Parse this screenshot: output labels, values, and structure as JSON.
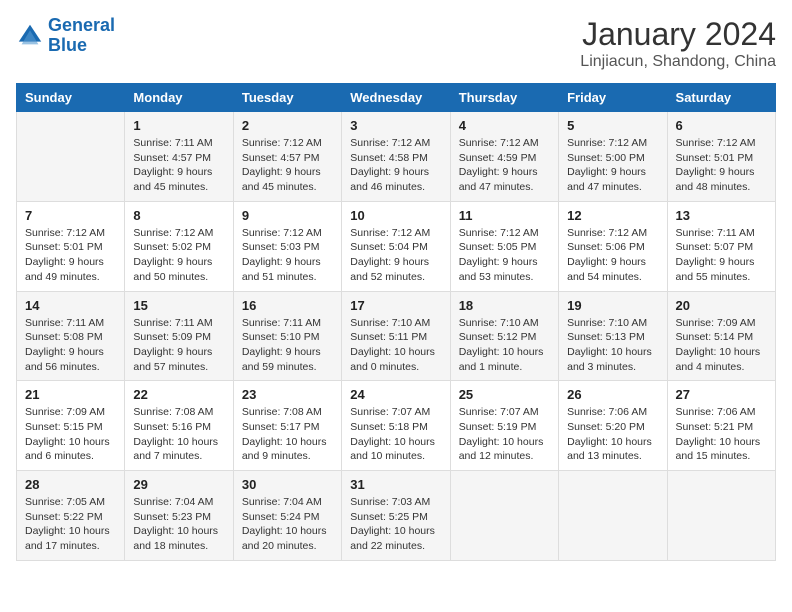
{
  "logo": {
    "text_general": "General",
    "text_blue": "Blue"
  },
  "title": "January 2024",
  "subtitle": "Linjiacun, Shandong, China",
  "header_days": [
    "Sunday",
    "Monday",
    "Tuesday",
    "Wednesday",
    "Thursday",
    "Friday",
    "Saturday"
  ],
  "weeks": [
    [
      {
        "day": "",
        "info": ""
      },
      {
        "day": "1",
        "info": "Sunrise: 7:11 AM\nSunset: 4:57 PM\nDaylight: 9 hours\nand 45 minutes."
      },
      {
        "day": "2",
        "info": "Sunrise: 7:12 AM\nSunset: 4:57 PM\nDaylight: 9 hours\nand 45 minutes."
      },
      {
        "day": "3",
        "info": "Sunrise: 7:12 AM\nSunset: 4:58 PM\nDaylight: 9 hours\nand 46 minutes."
      },
      {
        "day": "4",
        "info": "Sunrise: 7:12 AM\nSunset: 4:59 PM\nDaylight: 9 hours\nand 47 minutes."
      },
      {
        "day": "5",
        "info": "Sunrise: 7:12 AM\nSunset: 5:00 PM\nDaylight: 9 hours\nand 47 minutes."
      },
      {
        "day": "6",
        "info": "Sunrise: 7:12 AM\nSunset: 5:01 PM\nDaylight: 9 hours\nand 48 minutes."
      }
    ],
    [
      {
        "day": "7",
        "info": "Sunrise: 7:12 AM\nSunset: 5:01 PM\nDaylight: 9 hours\nand 49 minutes."
      },
      {
        "day": "8",
        "info": "Sunrise: 7:12 AM\nSunset: 5:02 PM\nDaylight: 9 hours\nand 50 minutes."
      },
      {
        "day": "9",
        "info": "Sunrise: 7:12 AM\nSunset: 5:03 PM\nDaylight: 9 hours\nand 51 minutes."
      },
      {
        "day": "10",
        "info": "Sunrise: 7:12 AM\nSunset: 5:04 PM\nDaylight: 9 hours\nand 52 minutes."
      },
      {
        "day": "11",
        "info": "Sunrise: 7:12 AM\nSunset: 5:05 PM\nDaylight: 9 hours\nand 53 minutes."
      },
      {
        "day": "12",
        "info": "Sunrise: 7:12 AM\nSunset: 5:06 PM\nDaylight: 9 hours\nand 54 minutes."
      },
      {
        "day": "13",
        "info": "Sunrise: 7:11 AM\nSunset: 5:07 PM\nDaylight: 9 hours\nand 55 minutes."
      }
    ],
    [
      {
        "day": "14",
        "info": "Sunrise: 7:11 AM\nSunset: 5:08 PM\nDaylight: 9 hours\nand 56 minutes."
      },
      {
        "day": "15",
        "info": "Sunrise: 7:11 AM\nSunset: 5:09 PM\nDaylight: 9 hours\nand 57 minutes."
      },
      {
        "day": "16",
        "info": "Sunrise: 7:11 AM\nSunset: 5:10 PM\nDaylight: 9 hours\nand 59 minutes."
      },
      {
        "day": "17",
        "info": "Sunrise: 7:10 AM\nSunset: 5:11 PM\nDaylight: 10 hours\nand 0 minutes."
      },
      {
        "day": "18",
        "info": "Sunrise: 7:10 AM\nSunset: 5:12 PM\nDaylight: 10 hours\nand 1 minute."
      },
      {
        "day": "19",
        "info": "Sunrise: 7:10 AM\nSunset: 5:13 PM\nDaylight: 10 hours\nand 3 minutes."
      },
      {
        "day": "20",
        "info": "Sunrise: 7:09 AM\nSunset: 5:14 PM\nDaylight: 10 hours\nand 4 minutes."
      }
    ],
    [
      {
        "day": "21",
        "info": "Sunrise: 7:09 AM\nSunset: 5:15 PM\nDaylight: 10 hours\nand 6 minutes."
      },
      {
        "day": "22",
        "info": "Sunrise: 7:08 AM\nSunset: 5:16 PM\nDaylight: 10 hours\nand 7 minutes."
      },
      {
        "day": "23",
        "info": "Sunrise: 7:08 AM\nSunset: 5:17 PM\nDaylight: 10 hours\nand 9 minutes."
      },
      {
        "day": "24",
        "info": "Sunrise: 7:07 AM\nSunset: 5:18 PM\nDaylight: 10 hours\nand 10 minutes."
      },
      {
        "day": "25",
        "info": "Sunrise: 7:07 AM\nSunset: 5:19 PM\nDaylight: 10 hours\nand 12 minutes."
      },
      {
        "day": "26",
        "info": "Sunrise: 7:06 AM\nSunset: 5:20 PM\nDaylight: 10 hours\nand 13 minutes."
      },
      {
        "day": "27",
        "info": "Sunrise: 7:06 AM\nSunset: 5:21 PM\nDaylight: 10 hours\nand 15 minutes."
      }
    ],
    [
      {
        "day": "28",
        "info": "Sunrise: 7:05 AM\nSunset: 5:22 PM\nDaylight: 10 hours\nand 17 minutes."
      },
      {
        "day": "29",
        "info": "Sunrise: 7:04 AM\nSunset: 5:23 PM\nDaylight: 10 hours\nand 18 minutes."
      },
      {
        "day": "30",
        "info": "Sunrise: 7:04 AM\nSunset: 5:24 PM\nDaylight: 10 hours\nand 20 minutes."
      },
      {
        "day": "31",
        "info": "Sunrise: 7:03 AM\nSunset: 5:25 PM\nDaylight: 10 hours\nand 22 minutes."
      },
      {
        "day": "",
        "info": ""
      },
      {
        "day": "",
        "info": ""
      },
      {
        "day": "",
        "info": ""
      }
    ]
  ]
}
